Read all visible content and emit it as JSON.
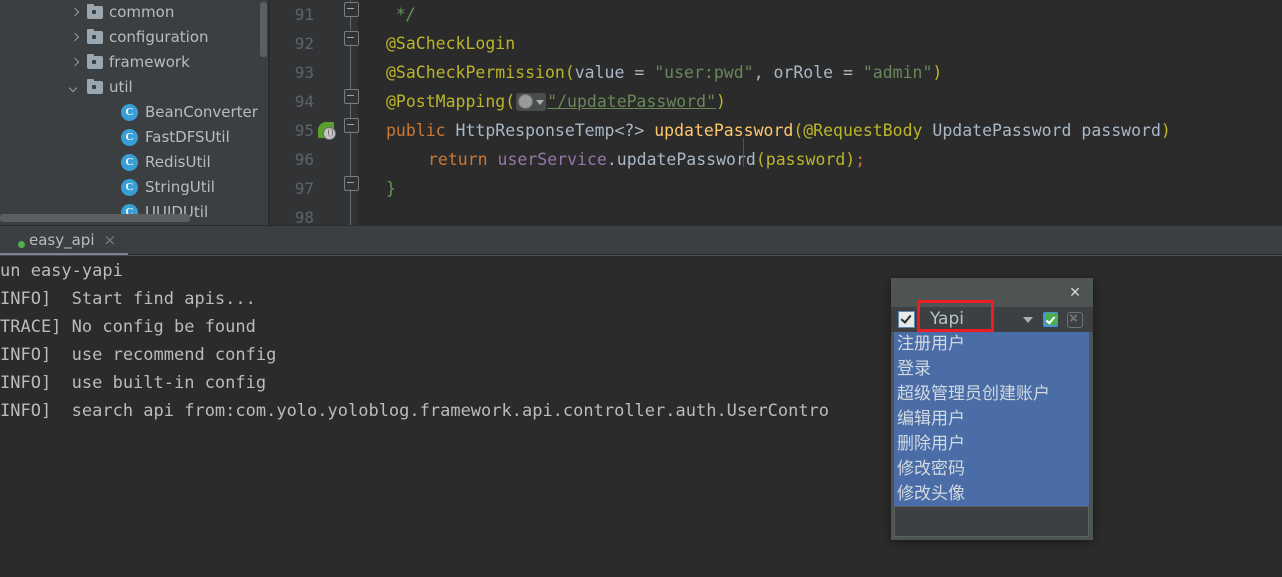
{
  "project_tree": {
    "items": [
      {
        "label": "common",
        "icon": "folder-icon",
        "arrow": "chevron-right-icon",
        "indent": 0,
        "type": "folder"
      },
      {
        "label": "configuration",
        "icon": "folder-icon",
        "arrow": "chevron-right-icon",
        "indent": 0,
        "type": "folder"
      },
      {
        "label": "framework",
        "icon": "folder-icon",
        "arrow": "chevron-right-icon",
        "indent": 0,
        "type": "folder"
      },
      {
        "label": "util",
        "icon": "folder-icon",
        "arrow": "chevron-down-icon",
        "indent": 0,
        "type": "folder"
      },
      {
        "label": "BeanConverter",
        "icon": "java-class-icon",
        "glyph": "C",
        "indent": 1,
        "type": "class"
      },
      {
        "label": "FastDFSUtil",
        "icon": "java-class-icon",
        "glyph": "C",
        "indent": 1,
        "type": "class"
      },
      {
        "label": "RedisUtil",
        "icon": "java-class-icon",
        "glyph": "C",
        "indent": 1,
        "type": "class"
      },
      {
        "label": "StringUtil",
        "icon": "java-class-icon",
        "glyph": "C",
        "indent": 1,
        "type": "class"
      },
      {
        "label": "UUIDUtil",
        "icon": "java-class-icon",
        "glyph": "C",
        "indent": 1,
        "type": "class"
      }
    ]
  },
  "editor": {
    "line_numbers": [
      "91",
      "92",
      "93",
      "94",
      "95",
      "96",
      "97",
      "98"
    ],
    "run_marker_line": "95",
    "lines": [
      {
        "num": "91",
        "text": " */"
      },
      {
        "num": "92",
        "text": "@SaCheckLogin"
      },
      {
        "num": "93",
        "text": "@SaCheckPermission(value = \"user:pwd\", orRole = \"admin\")"
      },
      {
        "num": "94",
        "text": "@PostMapping(\"/updatePassword\")"
      },
      {
        "num": "95",
        "text": "public HttpResponseTemp<?> updatePassword(@RequestBody UpdatePassword password)"
      },
      {
        "num": "96",
        "text": "    return userService.updatePassword(password);"
      },
      {
        "num": "97",
        "text": "}"
      },
      {
        "num": "98",
        "text": ""
      }
    ],
    "tokens": {
      "comment_close": " */",
      "anno_sacheck_login": "@SaCheckLogin",
      "anno_sacheck_permission": "@SaCheckPermission",
      "paren_open": "(",
      "value_param": "value",
      "equals": " = ",
      "str_user_pwd": "\"user:pwd\"",
      "comma": ", ",
      "orrole_param": "orRole",
      "str_admin": "\"admin\"",
      "paren_close": ")",
      "anno_postmapping": "@PostMapping",
      "url_path": "\"/updatePassword\"",
      "kw_public": "public",
      "type_response": "HttpResponseTemp<?>",
      "method_name": "updatePassword",
      "anno_requestbody": "@RequestBody",
      "type_update_password": "UpdatePassword",
      "param_password": "password",
      "kw_return": "return",
      "field_userservice": "userService",
      "dot": ".",
      "call_updatepassword": "updatePassword",
      "arg_password": "(password)",
      "semicolon": ";",
      "brace_close": "}"
    }
  },
  "run_panel": {
    "tab": {
      "label": "easy_api",
      "close_label": "×",
      "status_dot_color": "#4fb04f"
    },
    "console_lines": [
      "un easy-yapi",
      "INFO]  Start find apis...",
      "TRACE] No config be found",
      "INFO]  use recommend config",
      "INFO]  use built-in config",
      "INFO]  search api from:com.yolo.yoloblog.framework.api.controller.auth.UserContro"
    ]
  },
  "popup": {
    "close_label": "×",
    "toolbar": {
      "checkbox_checked": true,
      "value": "Yapi",
      "dropdown_icon": "chevron-down-icon",
      "confirm_icon": "green-check-icon",
      "cancel_icon": "cancel-x-icon",
      "highlight_color": "#ec1c24"
    },
    "list_items": [
      "注册用户",
      "登录",
      "超级管理员创建账户",
      "编辑用户",
      "删除用户",
      "修改密码",
      "修改头像"
    ]
  },
  "colors": {
    "editor_bg": "#2b2b2b",
    "panel_bg": "#3c3f41",
    "gutter_bg": "#313335",
    "list_selection": "#4a6da7",
    "dialog_bg": "#4e5451",
    "highlight_red": "#ec1c24"
  }
}
